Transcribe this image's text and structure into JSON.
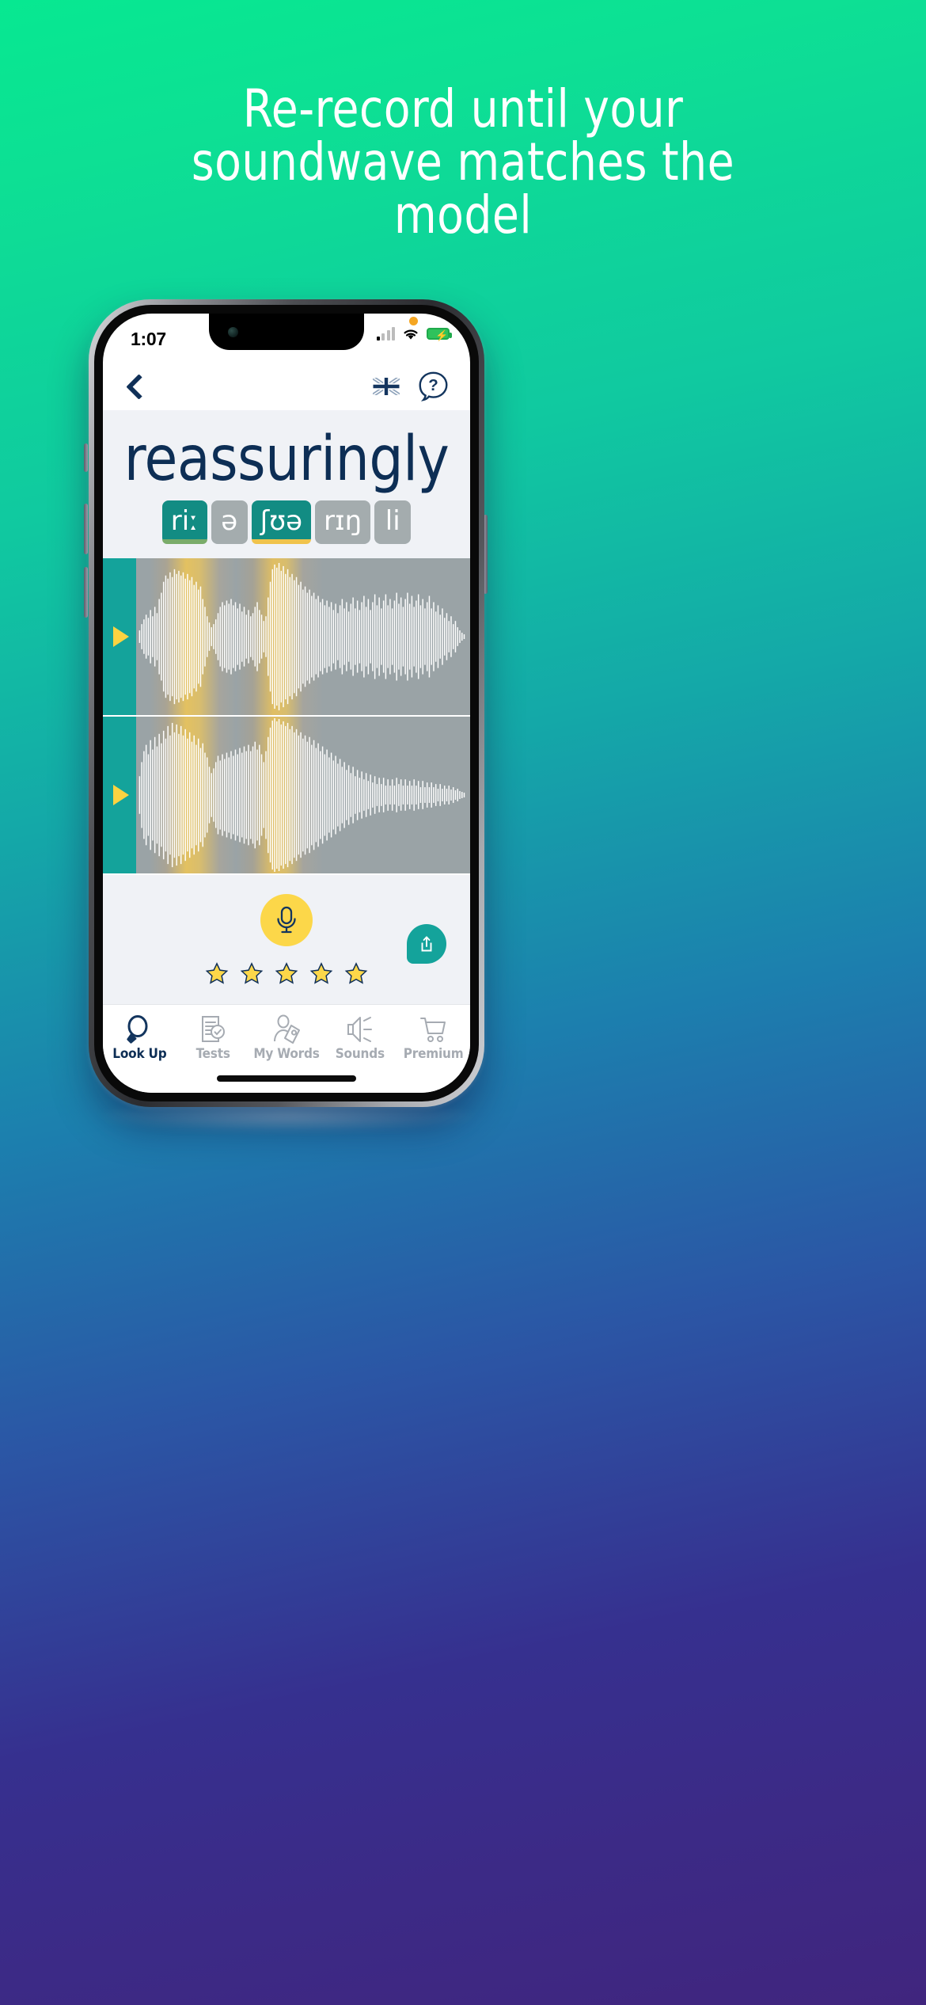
{
  "promo": {
    "headline_lines": [
      "Re-record until your",
      "soundwave matches the",
      "model"
    ],
    "bg_top_color": "#07E891",
    "bg_bottom_color": "#40257E"
  },
  "statusbar": {
    "time": "1:07",
    "mic_indicator": "orange-dot",
    "cellular": "signal-bars",
    "wifi": "wifi-icon",
    "battery": "battery-charging-icon",
    "battery_color": "#2fc25c"
  },
  "navbar": {
    "back": "back-chevron",
    "flag": "uk-flag",
    "flag_label": "English (UK)",
    "help": "help-speech-bubble",
    "help_glyph": "?"
  },
  "word_panel": {
    "word": "reassuringly",
    "word_color": "#0d2e55",
    "syllables": [
      {
        "text": "riː",
        "state": "selected",
        "underline": "#7aac6a"
      },
      {
        "text": "ə",
        "state": "normal",
        "underline": ""
      },
      {
        "text": "ʃʊə",
        "state": "selected",
        "underline": "#f0c34c"
      },
      {
        "text": "rɪŋ",
        "state": "normal",
        "underline": ""
      },
      {
        "text": "li",
        "state": "normal",
        "underline": ""
      }
    ],
    "chip_selected_color": "#128c83",
    "chip_normal_color": "#a4acae"
  },
  "waveforms": [
    {
      "name": "model-waveform",
      "play_label": "Play model",
      "accent": "#14a39b",
      "play_color": "#fcd341"
    },
    {
      "name": "user-waveform",
      "play_label": "Play recording",
      "accent": "#14a39b",
      "play_color": "#fcd341"
    }
  ],
  "controls": {
    "record_label": "Record",
    "record_color": "#fcd749",
    "share_label": "Share",
    "share_color": "#14a39b",
    "stars_total": 5,
    "stars_filled": 5,
    "star_fill_color": "#fcd749",
    "star_stroke_color": "#103058"
  },
  "tabbar": {
    "active_index": 0,
    "active_color": "#0d2e55",
    "inactive_color": "#a6abb2",
    "items": [
      {
        "label": "Look Up",
        "icon": "magnifier-icon"
      },
      {
        "label": "Tests",
        "icon": "document-check-icon"
      },
      {
        "label": "My Words",
        "icon": "person-reading-icon"
      },
      {
        "label": "Sounds",
        "icon": "speaker-icon"
      },
      {
        "label": "Premium",
        "icon": "shopping-cart-icon"
      }
    ]
  }
}
